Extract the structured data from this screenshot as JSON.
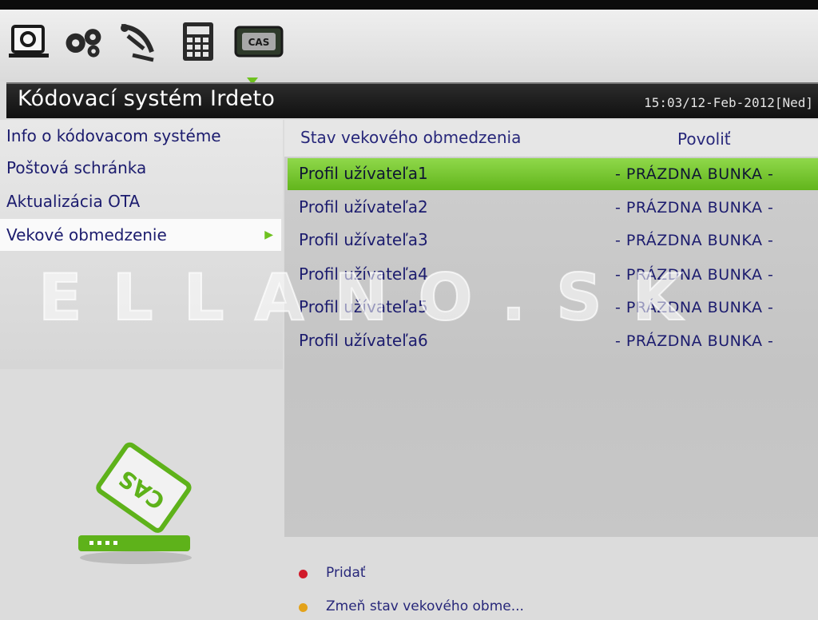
{
  "toolbar": {
    "icons": [
      "tv-screen-icon",
      "settings-gears-icon",
      "satellite-dish-icon",
      "calculator-icon",
      "cas-card-icon"
    ],
    "cas_label": "CAS",
    "accent_color": "#6ec11f"
  },
  "header": {
    "title": "Kódovací systém Irdeto",
    "datetime": "15:03/12-Feb-2012[Ned]"
  },
  "sidebar": {
    "items": [
      {
        "label": "Info o kódovacom systéme"
      },
      {
        "label": "Poštová schránka"
      },
      {
        "label": "Aktualizácia OTA"
      },
      {
        "label": "Vekové obmedzenie",
        "arrow": "▶"
      }
    ]
  },
  "main": {
    "col_status": "Stav vekového obmedzenia",
    "col_allow": "Povoliť",
    "rows": [
      {
        "name": "Profil užívateľa1",
        "state": "- PRÁZDNA BUNKA -"
      },
      {
        "name": "Profil užívateľa2",
        "state": "- PRÁZDNA BUNKA -"
      },
      {
        "name": "Profil užívateľa3",
        "state": "- PRÁZDNA BUNKA -"
      },
      {
        "name": "Profil užívateľa4",
        "state": "- PRÁZDNA BUNKA -"
      },
      {
        "name": "Profil užívateľa5",
        "state": "- PRÁZDNA BUNKA -"
      },
      {
        "name": "Profil užívateľa6",
        "state": "- PRÁZDNA BUNKA -"
      }
    ]
  },
  "watermark": "ELLANO.SK",
  "cas_logo_text": "CAS",
  "legend": [
    {
      "color": "#d11a2a",
      "label": "Pridať"
    },
    {
      "color": "#e3a21a",
      "label": "Zmeň stav vekového obme..."
    }
  ]
}
